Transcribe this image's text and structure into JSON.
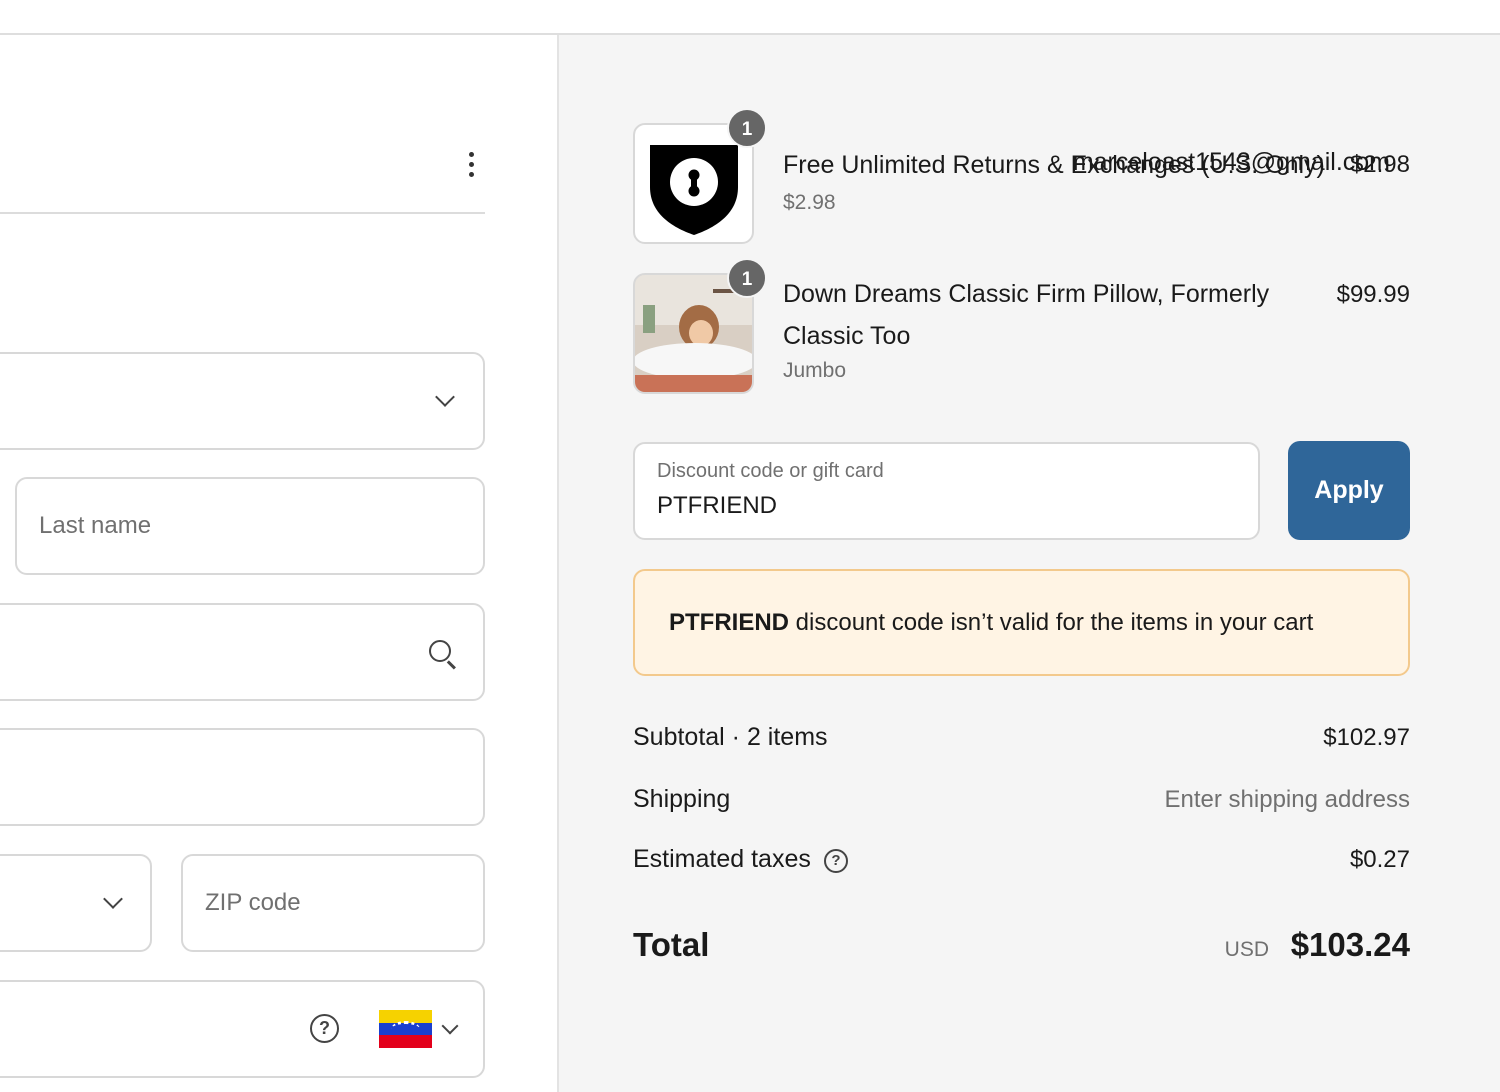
{
  "contact": {
    "email": "marceloast1543@gmail.com"
  },
  "form": {
    "last_name_placeholder": "Last name",
    "zip_placeholder": "ZIP code"
  },
  "cart": {
    "items": [
      {
        "title": "Free Unlimited Returns & Exchanges (U.S. Only)",
        "subtitle": "$2.98",
        "price": "$2.98",
        "quantity": "1"
      },
      {
        "title_line1": "Down Dreams Classic Firm Pillow, Formerly",
        "title_line2": "Classic Too",
        "subtitle": "Jumbo",
        "price": "$99.99",
        "quantity": "1"
      }
    ]
  },
  "discount": {
    "label": "Discount code or gift card",
    "value": "PTFRIEND",
    "apply_label": "Apply",
    "warning_code": "PTFRIEND",
    "warning_text": " discount code isn’t valid for the items in your cart"
  },
  "summary": {
    "subtotal_label": "Subtotal · 2 items",
    "subtotal_value": "$102.97",
    "shipping_label": "Shipping",
    "shipping_value": "Enter shipping address",
    "taxes_label": "Estimated taxes",
    "taxes_value": "$0.27",
    "total_label": "Total",
    "total_currency": "USD",
    "total_value": "$103.24"
  },
  "colors": {
    "apply_button": "#2f6699",
    "warning_bg": "#fff4e4",
    "warning_border": "#f3c98c"
  },
  "icons": [
    "kebab-menu-icon",
    "chevron-down-icon",
    "search-icon",
    "help-icon",
    "venezuela-flag-icon",
    "shield-lock-icon"
  ]
}
